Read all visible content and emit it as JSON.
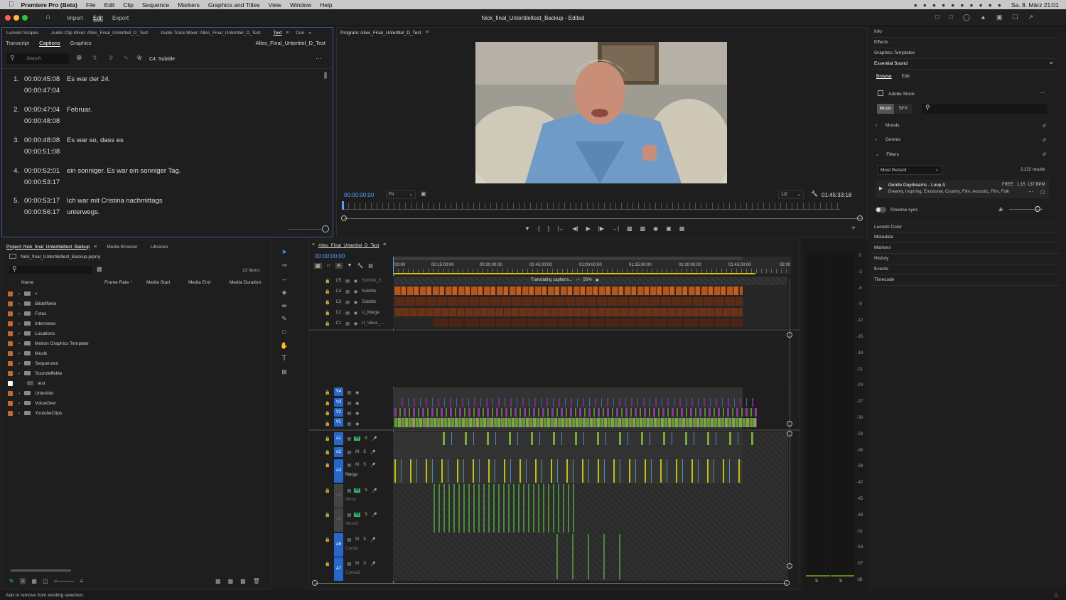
{
  "menubar": {
    "app": "Premiere Pro (Beta)",
    "items": [
      "File",
      "Edit",
      "Clip",
      "Sequence",
      "Markers",
      "Graphics and Titles",
      "View",
      "Window",
      "Help"
    ],
    "clock": "Sa. 8. März 21:01"
  },
  "titlebar": {
    "nav": [
      "Import",
      "Edit",
      "Export"
    ],
    "active_nav": "Edit",
    "title": "Nick_final_Untertiteltest_Backup - Edited"
  },
  "text_panel": {
    "tabs": [
      "Lumetri Scopes",
      "Audio Clip Mixer: Alles_Final_Untertitel_D_Test",
      "Audio Track Mixer: Alles_Final_Untertitel_D_Test",
      "Text",
      "Con"
    ],
    "subtabs": [
      "Transcript",
      "Captions",
      "Graphics"
    ],
    "active_subtab": "Captions",
    "sequence_name": "Alles_Final_Untertitel_D_Test",
    "search_placeholder": "Search",
    "track_label": "C4: Subtitle",
    "captions": [
      {
        "n": "1.",
        "start": "00:00:45:08",
        "end": "00:00:47:04",
        "text": "Es war der 24."
      },
      {
        "n": "2.",
        "start": "00:00:47:04",
        "end": "00:00:48:08",
        "text": "Februar."
      },
      {
        "n": "3.",
        "start": "00:00:48:08",
        "end": "00:00:51:08",
        "text": "Es war so, dass es"
      },
      {
        "n": "4.",
        "start": "00:00:52:01",
        "end": "00:00:53:17",
        "text": "ein sonniger. Es war ein sonniger Tag."
      },
      {
        "n": "5.",
        "start": "00:00:53:17",
        "end": "00:00:56:17",
        "text": "Ich war mit Cristina nachmittags",
        "text2": "unterwegs."
      }
    ]
  },
  "program_monitor": {
    "title": "Program: Alles_Final_Untertitel_D_Test",
    "timecode": "00:00:00:00",
    "fit": "Fit",
    "resolution": "1/2",
    "duration": "01:45:33:18"
  },
  "project_panel": {
    "tabs": [
      "Project: Nick_final_Untertiteltest_Backup",
      "Media Browser",
      "Libraries"
    ],
    "file": "Nick_final_Untertiteltest_Backup.prproj",
    "count": "13 items",
    "columns": [
      "Name",
      "Frame Rate",
      "Media Start",
      "Media End",
      "Media Duration"
    ],
    "items": [
      "+",
      "Bildeffekte",
      "Fotos",
      "Interviews",
      "Locations",
      "Motion Graphics Template",
      "Musik",
      "Sequenzen",
      "Soundeffekte",
      "test",
      "Untertitel",
      "VoiceOver",
      "YoutubeClips"
    ]
  },
  "timeline": {
    "sequence": "Alles_Final_Untertitel_D_Test",
    "timecode": "00:00:00:00",
    "ruler": [
      "00:00",
      "00:15:00:00",
      "00:30:00:00",
      "00:45:00:00",
      "01:00:00:00",
      "01:15:00:00",
      "01:30:00:00",
      "01:45:00:00",
      "02:00"
    ],
    "translating": "Translating captions...",
    "translate_pct": "50%",
    "caption_tracks": [
      {
        "id": "C5",
        "name": "Subtitle_E..."
      },
      {
        "id": "C4",
        "name": "Subtitle"
      },
      {
        "id": "C3",
        "name": "Subtitle"
      },
      {
        "id": "C2",
        "name": "U_Marga"
      },
      {
        "id": "C1",
        "name": "U_Vince_..."
      }
    ],
    "video_tracks": [
      "V4",
      "V3",
      "V2",
      "V1"
    ],
    "audio_tracks": [
      {
        "id": "A1",
        "name": ""
      },
      {
        "id": "A2",
        "name": ""
      },
      {
        "id": "A3",
        "name": "Marga"
      },
      {
        "id": "A4",
        "name": "Vince"
      },
      {
        "id": "A5",
        "name": "Vince2"
      },
      {
        "id": "A6",
        "name": "Carola"
      },
      {
        "id": "A7",
        "name": "Carola2"
      }
    ],
    "m_label": "M",
    "s_label": "S"
  },
  "meter": {
    "labels": [
      "0",
      "-3",
      "-6",
      "-9",
      "-12",
      "-15",
      "-18",
      "-21",
      "-24",
      "-27",
      "-30",
      "-33",
      "-36",
      "-39",
      "-42",
      "-45",
      "-48",
      "-51",
      "-54",
      "-57",
      "dB"
    ],
    "solo": [
      "S",
      "S"
    ]
  },
  "right_panel": {
    "items_top": [
      "Info",
      "Effects",
      "Graphics Templates"
    ],
    "essential_sound": "Essential Sound",
    "es_tabs": [
      "Browse",
      "Edit"
    ],
    "adobe_stock": "Adobe Stock",
    "music_tabs": [
      "Music",
      "SFX"
    ],
    "sections": [
      "Moods",
      "Genres",
      "Filters"
    ],
    "sort": "Most Recent",
    "results": "2,222 results",
    "track": {
      "title": "Gentle Daydreams - Loop A",
      "tags": "Dreamy, Inspiring, Emotional, Country, Film, Acoustic, Film, Folk",
      "price": "FREE",
      "length": "1:15",
      "bpm": "137 BPM"
    },
    "timeline_sync": "Timeline sync",
    "items_bottom": [
      "Lumetri Color",
      "Metadata",
      "Markers",
      "History",
      "Events",
      "Timecode"
    ]
  },
  "status": "Add or remove from existing selection."
}
